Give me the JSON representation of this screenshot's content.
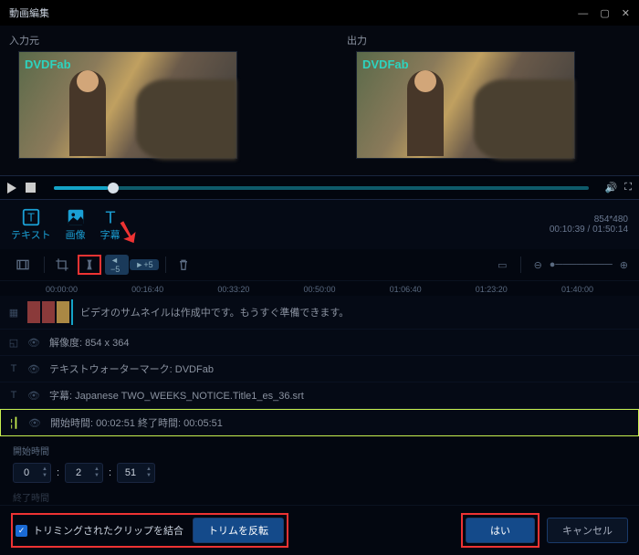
{
  "title": "動画編集",
  "preview": {
    "source_label": "入力元",
    "output_label": "出力",
    "watermark": "DVDFab"
  },
  "tabs": {
    "text": "テキスト",
    "image": "画像",
    "subtitle": "字幕"
  },
  "meta": {
    "resolution": "854*480",
    "time": "00:10:39 / 01:50:14"
  },
  "toolbar_chips": {
    "back": "◄ −5",
    "fwd": "►+5"
  },
  "ruler": [
    "00:00:00",
    "00:16:40",
    "00:33:20",
    "00:50:00",
    "01:06:40",
    "01:23:20",
    "01:40:00"
  ],
  "tracks": {
    "video_msg": "ビデオのサムネイルは作成中です。もうすぐ準備できます。",
    "crop": "解像度: 854 x 364",
    "textwm": "テキストウォーターマーク: DVDFab",
    "subtitle": "字幕: Japanese    TWO_WEEKS_NOTICE.Title1_es_36.srt",
    "trim": "開始時間: 00:02:51    終了時間: 00:05:51"
  },
  "panel": {
    "start_label": "開始時間",
    "end_label": "終了時間",
    "h": "0",
    "m": "2",
    "s": "51"
  },
  "footer": {
    "merge_label": "トリミングされたクリップを結合",
    "invert_label": "トリムを反転",
    "ok": "はい",
    "cancel": "キャンセル"
  }
}
